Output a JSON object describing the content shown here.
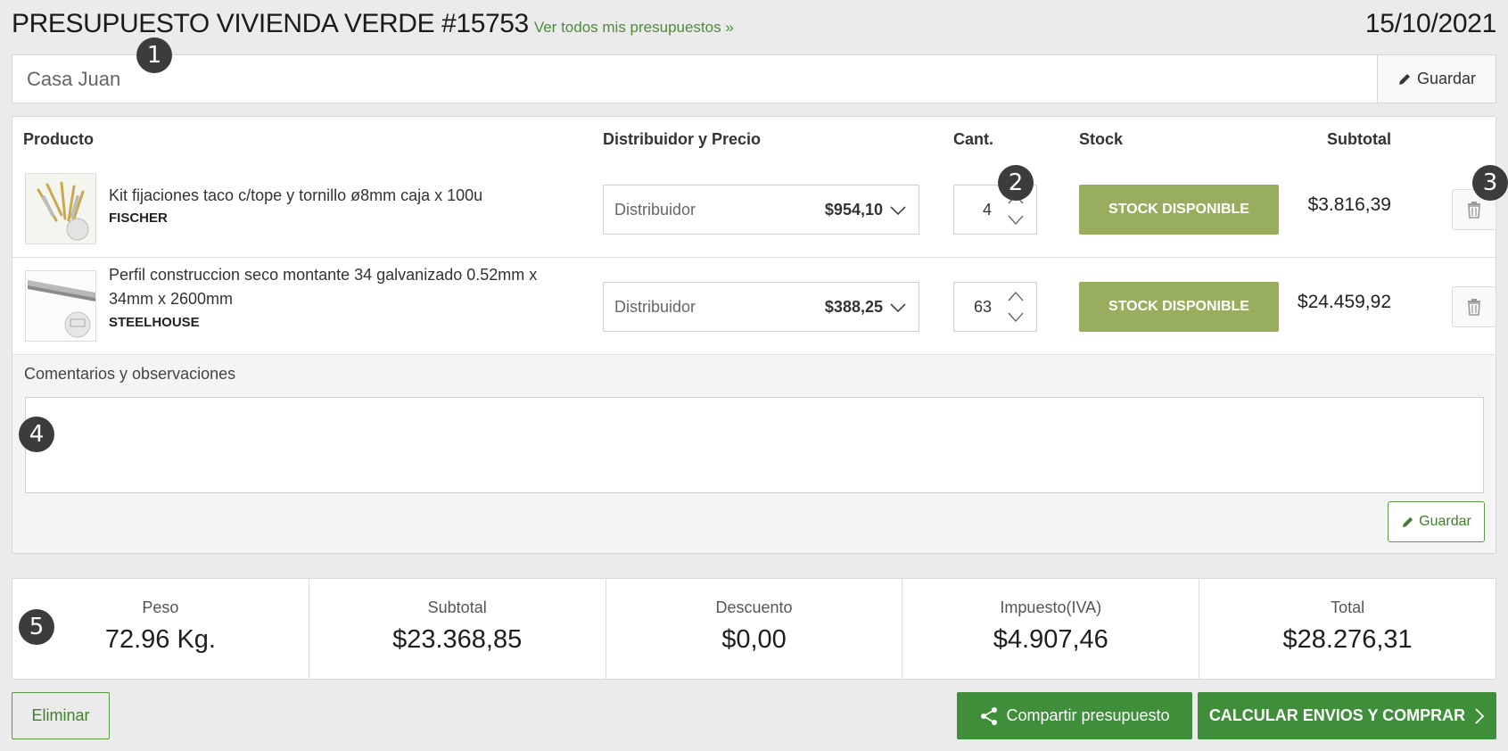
{
  "header": {
    "title": "PRESUPUESTO VIVIENDA VERDE #15753",
    "all_link": "Ver todos mis presupuestos »",
    "date": "15/10/2021"
  },
  "name_field": {
    "value": "Casa Juan",
    "save_label": "Guardar"
  },
  "table": {
    "columns": [
      "Producto",
      "Distribuidor y Precio",
      "Cant.",
      "Stock",
      "Subtotal"
    ],
    "rows": [
      {
        "name": "Kit fijaciones taco c/tope y tornillo ø8mm caja x 100u",
        "brand": "FISCHER",
        "distributor_label": "Distribuidor",
        "price": "$954,10",
        "quantity": "4",
        "stock": "STOCK DISPONIBLE",
        "subtotal": "$3.816,39"
      },
      {
        "name": "Perfil construccion seco montante 34 galvanizado 0.52mm x 34mm x 2600mm",
        "brand": "STEELHOUSE",
        "distributor_label": "Distribuidor",
        "price": "$388,25",
        "quantity": "63",
        "stock": "STOCK DISPONIBLE",
        "subtotal": "$24.459,92"
      }
    ]
  },
  "comments": {
    "label": "Comentarios y observaciones",
    "value": "",
    "save_label": "Guardar"
  },
  "totals": [
    {
      "label": "Peso",
      "value": "72.96 Kg."
    },
    {
      "label": "Subtotal",
      "value": "$23.368,85"
    },
    {
      "label": "Descuento",
      "value": "$0,00"
    },
    {
      "label": "Impuesto(IVA)",
      "value": "$4.907,46"
    },
    {
      "label": "Total",
      "value": "$28.276,31"
    }
  ],
  "actions": {
    "delete": "Eliminar",
    "share": "Compartir presupuesto",
    "buy": "CALCULAR ENVIOS Y COMPRAR"
  },
  "markers": [
    "1",
    "2",
    "3",
    "4",
    "5"
  ],
  "colors": {
    "accent": "#3f8f3a",
    "stock": "#99ad5e",
    "link": "#4d8c3a"
  }
}
